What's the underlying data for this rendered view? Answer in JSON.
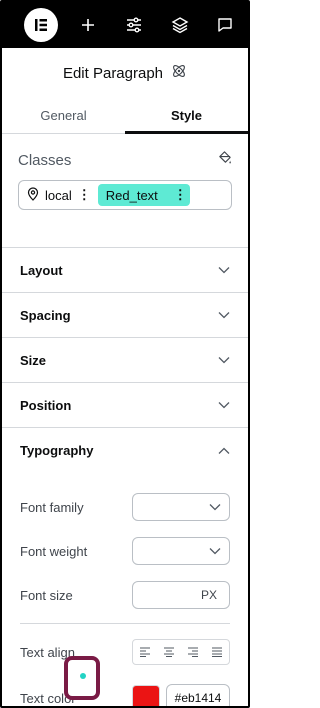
{
  "topbar": {
    "logo_icon": "elementor-logo-icon",
    "icons": [
      "plus-icon",
      "sliders-icon",
      "layers-icon",
      "comment-icon"
    ]
  },
  "panel": {
    "title": "Edit Paragraph",
    "title_icon": "atom-icon"
  },
  "tabs": [
    {
      "label": "General",
      "active": false
    },
    {
      "label": "Style",
      "active": true
    }
  ],
  "classes": {
    "label": "Classes",
    "chips": [
      {
        "label": "local",
        "icon": "location-pin-icon"
      },
      {
        "label": "Red_text",
        "color": "#5eead4"
      }
    ]
  },
  "sections": [
    {
      "label": "Layout"
    },
    {
      "label": "Spacing"
    },
    {
      "label": "Size"
    },
    {
      "label": "Position"
    },
    {
      "label": "Typography"
    }
  ],
  "typography": {
    "font_family_label": "Font family",
    "font_weight_label": "Font weight",
    "font_size_label": "Font size",
    "font_size_unit": "PX",
    "text_align_label": "Text align",
    "text_color_label": "Text color",
    "text_color_hex": "#eb1414",
    "text_color_swatch": "#eb1414"
  },
  "colors": {
    "indicator_dot": "#23d3c4",
    "highlight_border": "#7a1b45"
  }
}
